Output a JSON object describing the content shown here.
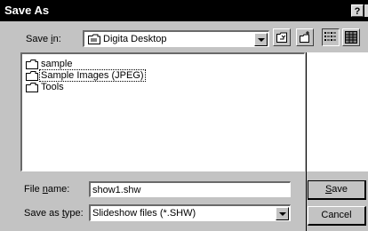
{
  "window": {
    "title": "Save As",
    "help_label": "?"
  },
  "save_in": {
    "label_pre": "Save ",
    "label_underlined": "i",
    "label_post": "n:",
    "value": "Digita Desktop"
  },
  "toolbar": {
    "icons": [
      "up-one-level-icon",
      "create-new-folder-icon",
      "list-view-icon",
      "details-view-icon"
    ]
  },
  "files": [
    {
      "name": "sample",
      "icon": "folder-icon",
      "selected": false
    },
    {
      "name": "Sample Images (JPEG)",
      "icon": "folder-icon",
      "selected": true
    },
    {
      "name": "Tools",
      "icon": "folder-icon",
      "selected": false
    }
  ],
  "file_name": {
    "label_pre": "File ",
    "label_underlined": "n",
    "label_post": "ame:",
    "value": "show1.shw"
  },
  "save_as_type": {
    "label_pre": "Save as ",
    "label_underlined": "t",
    "label_post": "ype:",
    "value": "Slideshow files (*.SHW)"
  },
  "buttons": {
    "save_underlined": "S",
    "save_rest": "ave",
    "cancel": "Cancel"
  }
}
